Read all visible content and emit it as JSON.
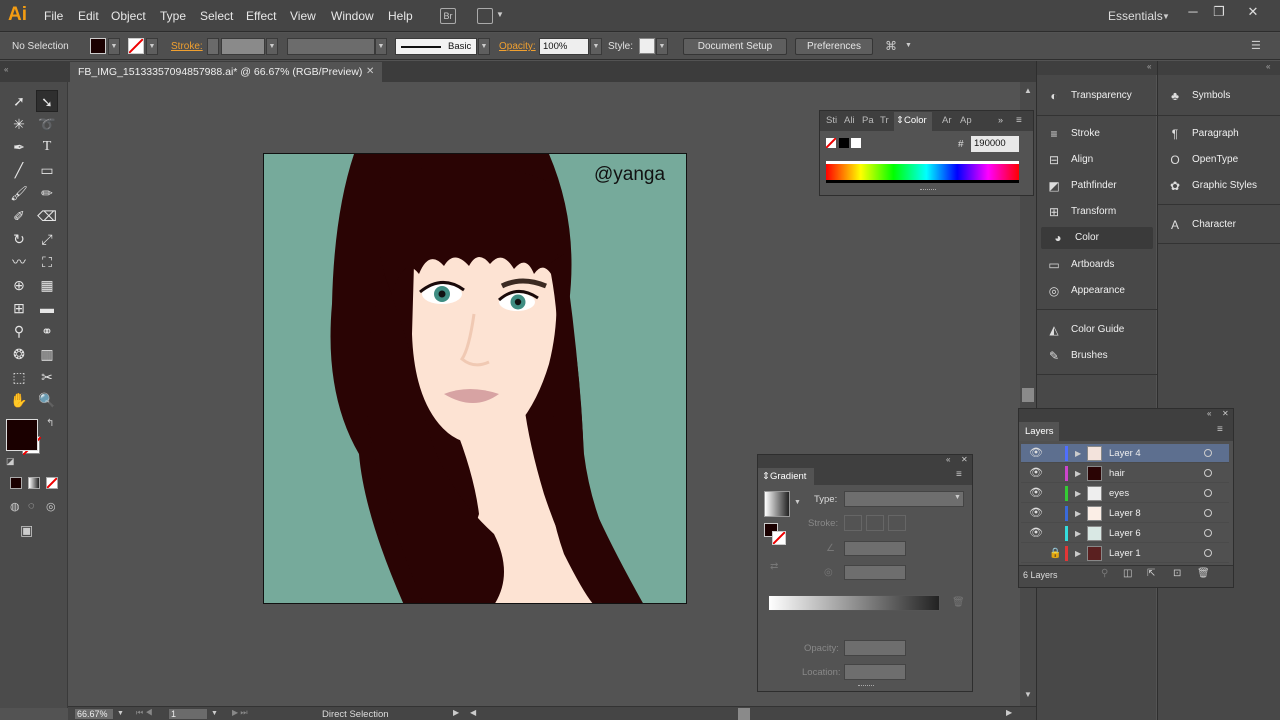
{
  "app": {
    "logo": "Ai",
    "workspace": "Essentials"
  },
  "menu": [
    "File",
    "Edit",
    "Object",
    "Type",
    "Select",
    "Effect",
    "View",
    "Window",
    "Help"
  ],
  "window_controls": [
    "─",
    "❐",
    "✕"
  ],
  "control_bar": {
    "selection_status": "No Selection",
    "stroke_label": "Stroke:",
    "brush_label": "Basic",
    "opacity_label": "Opacity:",
    "opacity_value": "100%",
    "style_label": "Style:",
    "document_setup": "Document Setup",
    "preferences": "Preferences"
  },
  "document_tab": {
    "title": "FB_IMG_1513335709485798­8.ai* @ 66.67% (RGB/Preview)",
    "close": "✕"
  },
  "artboard": {
    "watermark": "@yanga",
    "background": "#76aa9b",
    "hair_color": "#2a0404",
    "skin_color": "#fde3d3"
  },
  "status_bar": {
    "zoom": "66.67%",
    "artboard_num": "1",
    "tool": "Direct Selection"
  },
  "color_panel": {
    "tabs": [
      "Sti",
      "Ali",
      "Pa",
      "Tr",
      "Color",
      "Ar",
      "Ap"
    ],
    "hex_label": "#",
    "hex_value": "190000"
  },
  "dock_col1": [
    {
      "icon": "transparency-icon",
      "glyph": "◐",
      "label": "Transparency"
    },
    {
      "icon": "stroke-icon",
      "glyph": "≡",
      "label": "Stroke"
    },
    {
      "icon": "align-icon",
      "glyph": "⊟",
      "label": "Align"
    },
    {
      "icon": "pathfinder-icon",
      "glyph": "◩",
      "label": "Pathfinder"
    },
    {
      "icon": "transform-icon",
      "glyph": "⊞",
      "label": "Transform"
    },
    {
      "icon": "color-icon",
      "glyph": "◕",
      "label": "Color"
    },
    {
      "icon": "artboards-icon",
      "glyph": "▭",
      "label": "Artboards"
    },
    {
      "icon": "appearance-icon",
      "glyph": "◎",
      "label": "Appearance"
    },
    {
      "icon": "color-guide-icon",
      "glyph": "◭",
      "label": "Color Guide"
    },
    {
      "icon": "brushes-icon",
      "glyph": "✎",
      "label": "Brushes"
    }
  ],
  "dock_col2": [
    {
      "icon": "symbols-icon",
      "glyph": "♣",
      "label": "Symbols"
    },
    {
      "icon": "paragraph-icon",
      "glyph": "¶",
      "label": "Paragraph"
    },
    {
      "icon": "opentype-icon",
      "glyph": "O",
      "label": "OpenType"
    },
    {
      "icon": "graphic-styles-icon",
      "glyph": "✿",
      "label": "Graphic Styles"
    },
    {
      "icon": "character-icon",
      "glyph": "A",
      "label": "Character"
    }
  ],
  "layers_panel": {
    "title": "Layers",
    "layers": [
      {
        "name": "Layer 4",
        "color": "#4f6fff",
        "locked": false,
        "selected": true
      },
      {
        "name": "hair",
        "color": "#cc44cc",
        "locked": false,
        "selected": false
      },
      {
        "name": "eyes",
        "color": "#33cc33",
        "locked": false,
        "selected": false
      },
      {
        "name": "Layer 8",
        "color": "#3a6ad9",
        "locked": false,
        "selected": false
      },
      {
        "name": "Layer 6",
        "color": "#33dddd",
        "locked": false,
        "selected": false
      },
      {
        "name": "Layer 1",
        "color": "#e23636",
        "locked": true,
        "selected": false
      }
    ],
    "count": "6 Layers"
  },
  "gradient_panel": {
    "title": "Gradient",
    "type_label": "Type:",
    "stroke_label": "Stroke:",
    "opacity_label": "Opacity:",
    "location_label": "Location:"
  }
}
